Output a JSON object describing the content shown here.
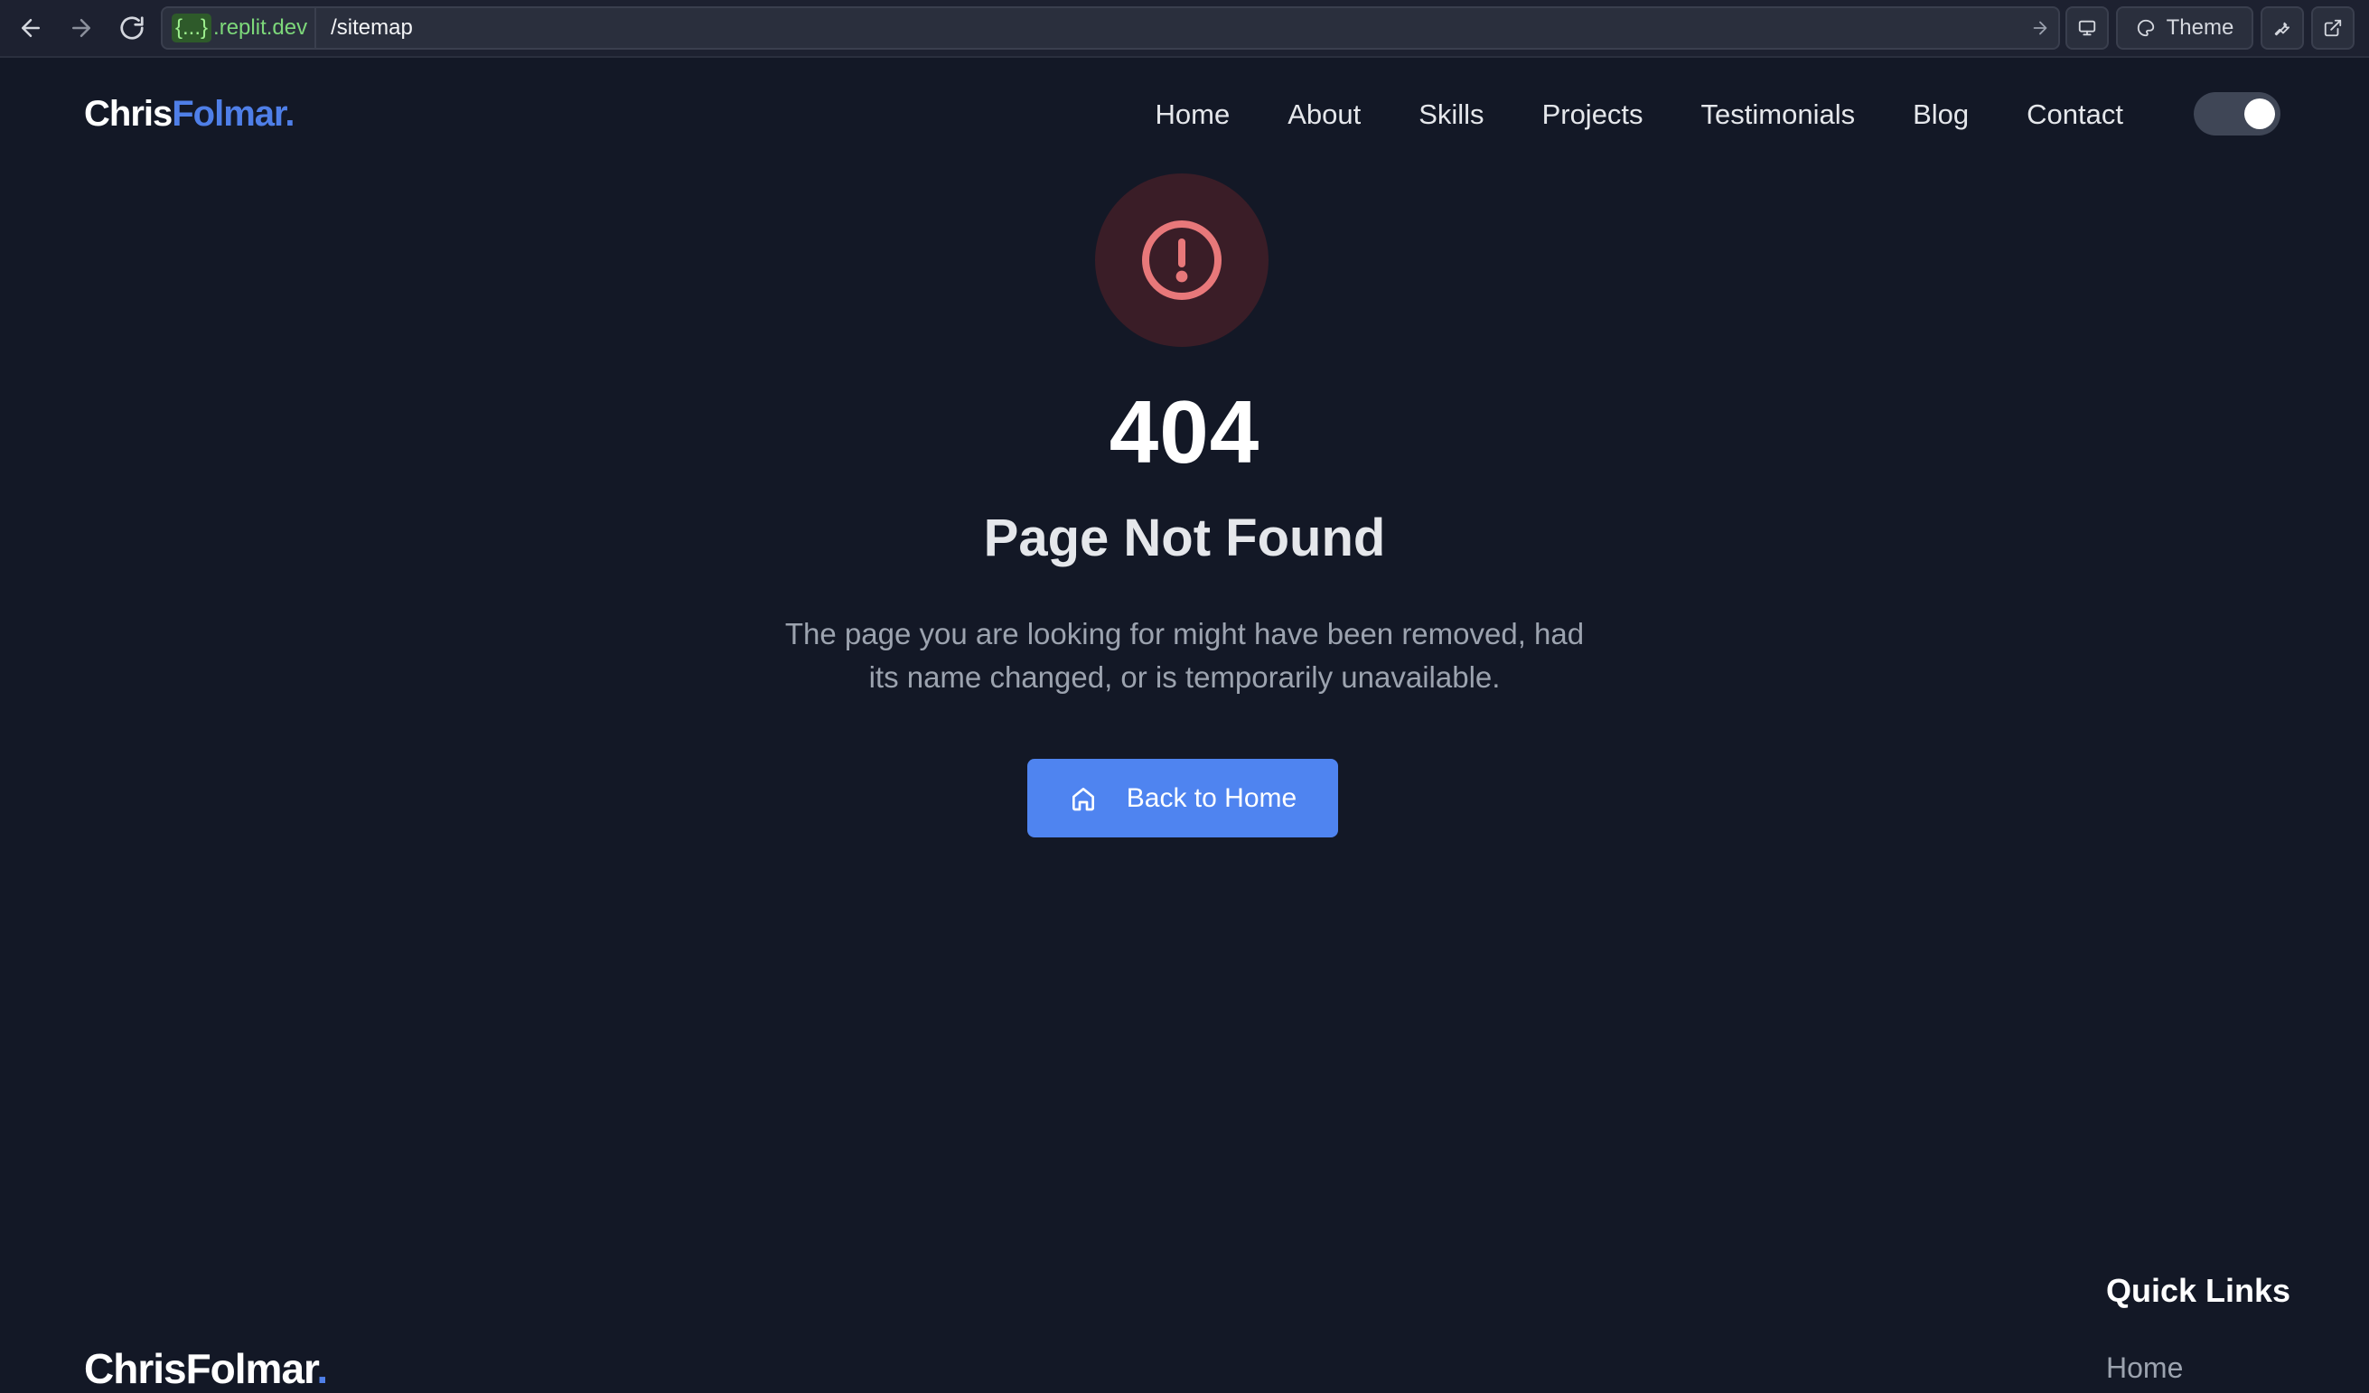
{
  "browser": {
    "host_braces": "{...}",
    "host_domain": ".replit.dev",
    "path": "/sitemap",
    "theme_label": "Theme"
  },
  "header": {
    "logo_first": "Chris",
    "logo_second": "Folmar",
    "logo_dot": ".",
    "nav": [
      "Home",
      "About",
      "Skills",
      "Projects",
      "Testimonials",
      "Blog",
      "Contact"
    ],
    "dark_mode": true
  },
  "main": {
    "code": "404",
    "title": "Page Not Found",
    "description": "The page you are looking for might have been removed, had its name changed, or is temporarily unavailable.",
    "button_label": "Back to Home"
  },
  "footer": {
    "logo": "ChrisFolmar",
    "logo_dot": ".",
    "quick_links_title": "Quick Links",
    "quick_links": [
      "Home"
    ]
  },
  "colors": {
    "background": "#131826",
    "accent": "#4f84f0",
    "error": "#e8787a"
  }
}
